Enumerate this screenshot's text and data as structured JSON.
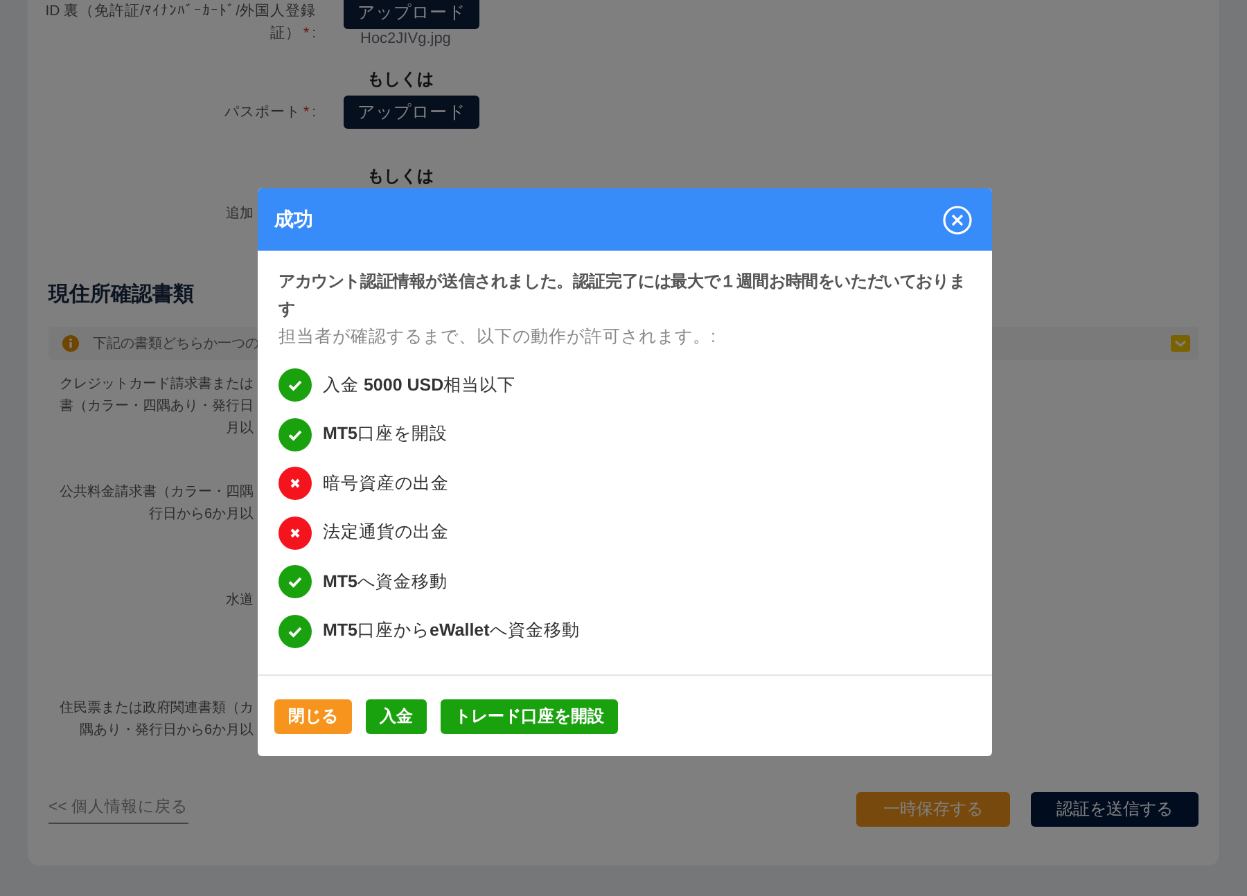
{
  "identity": {
    "fields": [
      {
        "kind": "upload",
        "label_lines": [
          "ID 裏（免許証/ﾏｲﾅﾝﾊﾞｰｶｰﾄﾞ/外国人登録",
          "証）"
        ],
        "required_mark": "*",
        "colon": ":",
        "button": "アップロード",
        "file": "Hoc2JIVg.jpg"
      },
      {
        "kind": "separator",
        "text": "もしくは"
      },
      {
        "kind": "upload",
        "label_lines": [
          "パスポート"
        ],
        "required_mark": "*",
        "colon": ":",
        "button": "アップロード"
      },
      {
        "kind": "separator",
        "text": "もしくは"
      },
      {
        "kind": "label",
        "label": "追加"
      }
    ]
  },
  "address": {
    "title": "現住所確認書類",
    "notice": "下記の書類どちらか一つの",
    "documents": [
      {
        "lines": [
          "クレジットカード請求書または",
          "書（カラー・四隅あり・発行日",
          "月以"
        ]
      },
      {
        "lines": [
          "公共料金請求書（カラー・四隅",
          "行日から6か月以"
        ]
      },
      {
        "lines": [
          "水道"
        ]
      },
      {
        "lines": [
          "住民票または政府関連書類（カ",
          "隅あり・発行日から6か月以"
        ]
      }
    ]
  },
  "footer": {
    "back_link": "<< 個人情報に戻る",
    "save_button": "一時保存する",
    "submit_button": "認証を送信する"
  },
  "dialog": {
    "title": "成功",
    "message": "アカウント認証情報が送信されました。認証完了には最大で１週間お時間をいただいております",
    "subtitle": "担当者が確認するまで、以下の動作が許可されます。:",
    "permissions": [
      {
        "text": "入金 **5000 USD**相当以下",
        "allowed": true
      },
      {
        "text": "**MT5**口座を開設",
        "allowed": true
      },
      {
        "text": "暗号資産の出金",
        "allowed": false
      },
      {
        "text": "法定通貨の出金",
        "allowed": false
      },
      {
        "text": "**MT5**へ資金移動",
        "allowed": true
      },
      {
        "text": "**MT5**口座から**eWallet**へ資金移動",
        "allowed": true
      }
    ],
    "buttons": [
      {
        "label": "閉じる",
        "kind": "close"
      },
      {
        "label": "入金",
        "kind": "primary"
      },
      {
        "label": "トレード口座を開設",
        "kind": "primary"
      }
    ]
  }
}
